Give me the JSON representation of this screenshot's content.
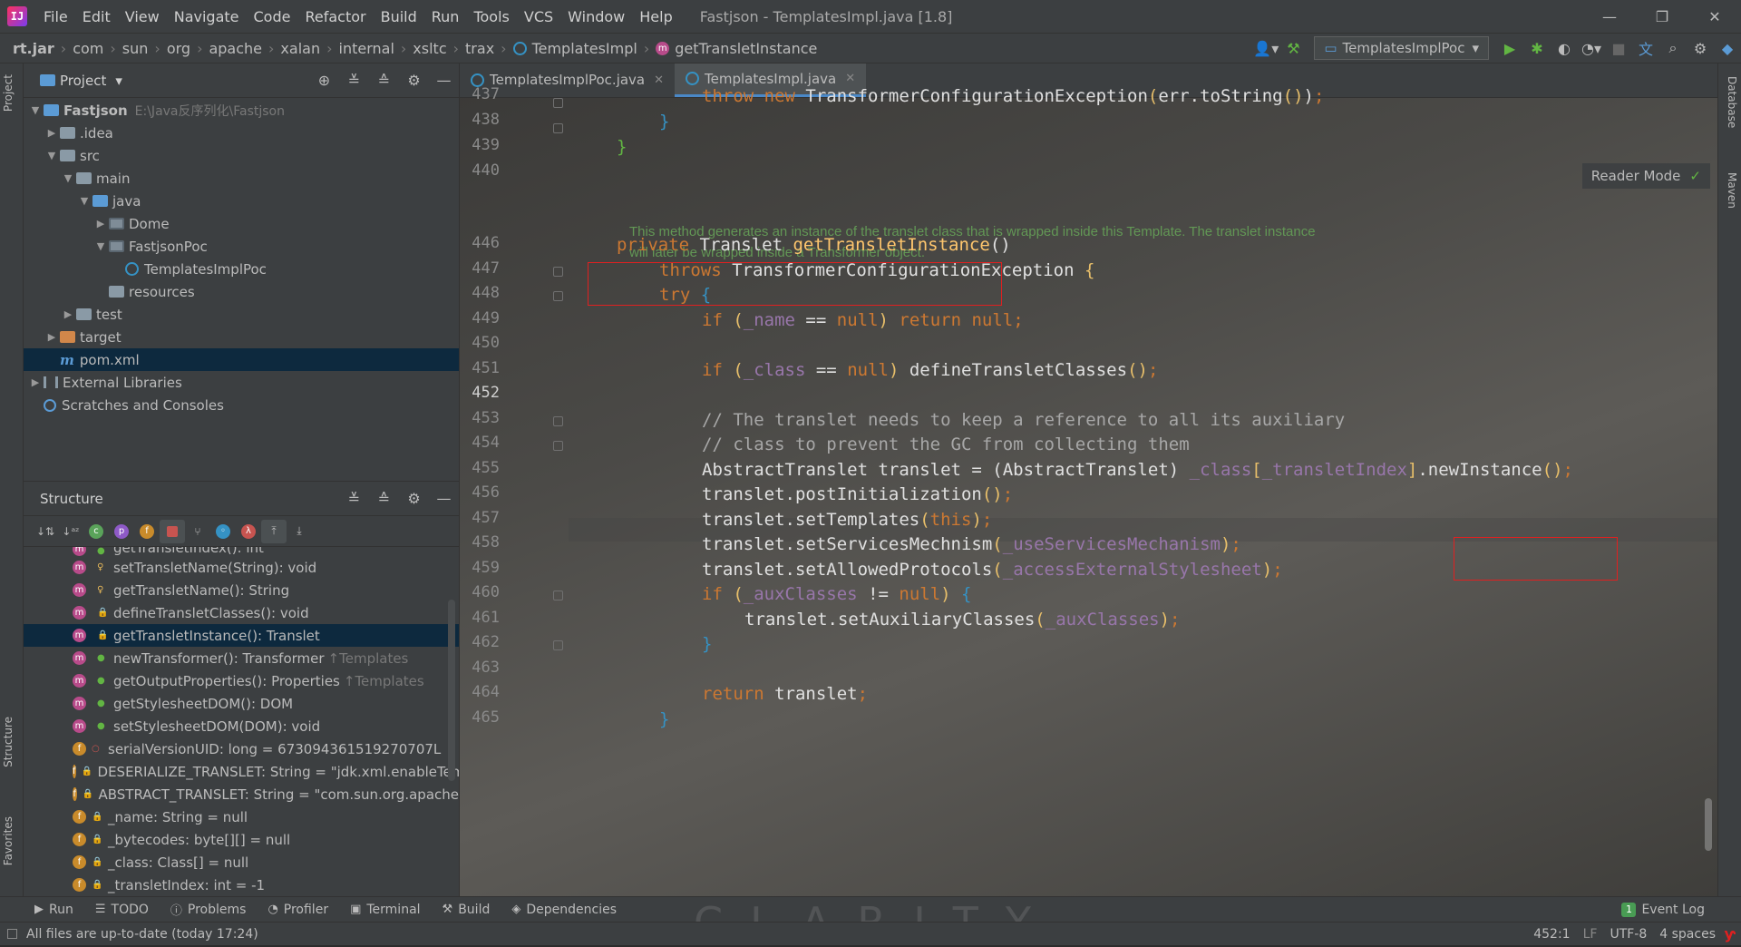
{
  "app": {
    "logo": "IJ",
    "menu": [
      "File",
      "Edit",
      "View",
      "Navigate",
      "Code",
      "Refactor",
      "Build",
      "Run",
      "Tools",
      "VCS",
      "Window",
      "Help"
    ],
    "title": "Fastjson - TemplatesImpl.java [1.8]"
  },
  "breadcrumbs": [
    "rt.jar",
    "com",
    "sun",
    "org",
    "apache",
    "xalan",
    "internal",
    "xsltc",
    "trax",
    "TemplatesImpl",
    "getTransletInstance"
  ],
  "run_config": "TemplatesImplPoc",
  "project": {
    "title": "Project",
    "root_name": "Fastjson",
    "root_path": "E:\\Java反序列化\\Fastjson",
    "items": [
      ".idea",
      "src",
      "main",
      "java",
      "Dome",
      "FastjsonPoc",
      "TemplatesImplPoc",
      "resources",
      "test",
      "target",
      "pom.xml",
      "External Libraries",
      "Scratches and Consoles"
    ]
  },
  "structure": {
    "title": "Structure",
    "items": [
      {
        "label": "getTransletIndex(): int",
        "suffix": ""
      },
      {
        "label": "setTransletName(String): void",
        "suffix": ""
      },
      {
        "label": "getTransletName(): String",
        "suffix": ""
      },
      {
        "label": "defineTransletClasses(): void",
        "suffix": ""
      },
      {
        "label": "getTransletInstance(): Translet",
        "suffix": ""
      },
      {
        "label": "newTransformer(): Transformer",
        "suffix": "↑Templates"
      },
      {
        "label": "getOutputProperties(): Properties",
        "suffix": "↑Templates"
      },
      {
        "label": "getStylesheetDOM(): DOM",
        "suffix": ""
      },
      {
        "label": "setStylesheetDOM(DOM): void",
        "suffix": ""
      },
      {
        "label": "serialVersionUID: long = 673094361519270707L",
        "suffix": ""
      },
      {
        "label": "DESERIALIZE_TRANSLET: String = \"jdk.xml.enableTem",
        "suffix": ""
      },
      {
        "label": "ABSTRACT_TRANSLET: String = \"com.sun.org.apache",
        "suffix": ""
      },
      {
        "label": "_name: String = null",
        "suffix": ""
      },
      {
        "label": "_bytecodes: byte[][] = null",
        "suffix": ""
      },
      {
        "label": "_class: Class[] = null",
        "suffix": ""
      },
      {
        "label": "_transletIndex: int = -1",
        "suffix": ""
      }
    ]
  },
  "editor": {
    "tabs": [
      "TemplatesImplPoc.java",
      "TemplatesImpl.java"
    ],
    "reader_mode": "Reader Mode",
    "doc_comment": "This method generates an instance of the translet class that is wrapped inside this Template. The translet instance will later be wrapped inside a Transformer object.",
    "line_numbers": [
      "437",
      "438",
      "439",
      "440",
      "446",
      "447",
      "448",
      "449",
      "450",
      "451",
      "452",
      "453",
      "454",
      "455",
      "456",
      "457",
      "458",
      "459",
      "460",
      "461",
      "462",
      "463",
      "464",
      "465"
    ],
    "current_line": "452"
  },
  "toolwindows": [
    "Run",
    "TODO",
    "Problems",
    "Profiler",
    "Terminal",
    "Build",
    "Dependencies"
  ],
  "event_log": {
    "count": "1",
    "label": "Event Log"
  },
  "side_tabs": {
    "left": [
      "Project",
      "Structure",
      "Favorites"
    ],
    "right": [
      "Database",
      "Maven"
    ]
  },
  "status": {
    "message": "All files are up-to-date (today 17:24)",
    "position": "452:1",
    "line_sep": "LF",
    "encoding": "UTF-8",
    "indent": "4 spaces"
  },
  "watermark": "CLARITY"
}
